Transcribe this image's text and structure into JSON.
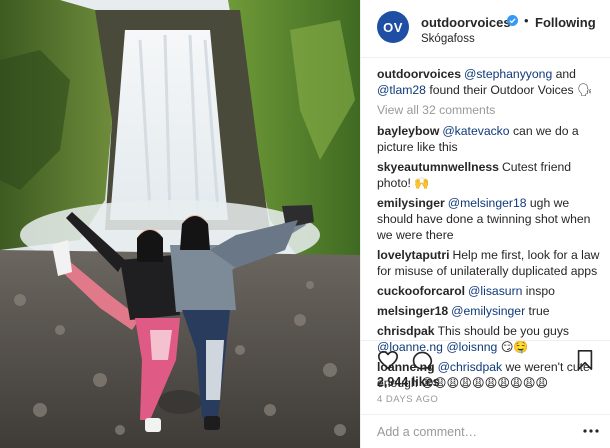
{
  "post": {
    "image": {
      "alt": "Two women posing with legs kicked up in front of Skógafoss waterfall"
    }
  },
  "header": {
    "avatar_text": "OV",
    "username": "outdoorvoices",
    "separator": "•",
    "follow_label": "Following",
    "location": "Skógafoss"
  },
  "caption": {
    "username": "outdoorvoices",
    "mention1": "@stephanyyong",
    "text1": " and ",
    "mention2": "@tlam28",
    "text2": " found their Outdoor Voices 🗣"
  },
  "view_all_label": "View all 32 comments",
  "comments": [
    {
      "user": "bayleybow",
      "mention": "@katevacko",
      "text": " can we do a picture like this"
    },
    {
      "user": "skyeautumnwellness",
      "mention": "",
      "text": "Cutest friend photo! 🙌"
    },
    {
      "user": "emilysinger",
      "mention": "@melsinger18",
      "text": " ugh we should have done a twinning shot when we were there"
    },
    {
      "user": "lovelytaputri",
      "mention": "",
      "text": "Help me first, look for a law for misuse of unilaterally duplicated apps"
    },
    {
      "user": "cuckooforcarol",
      "mention": "@lisasurn",
      "text": " inspo"
    },
    {
      "user": "melsinger18",
      "mention": "@emilysinger",
      "text": " true"
    },
    {
      "user": "chrisdpak",
      "mention": "",
      "text": "This should be you guys ",
      "mention_after": "@loanne.ng",
      "text_after": " ",
      "mention_after2": "@loisnng",
      "text_after2": " 😏🤤"
    },
    {
      "user": "loanne.ng",
      "mention": "@chrisdpak",
      "text": " we weren't cute enough 😩😩😩😩😩😩😩😩😩😩"
    }
  ],
  "actions": {
    "like_icon": "heart-icon",
    "comment_icon": "comment-icon",
    "save_icon": "bookmark-icon"
  },
  "likes_text": "2,944 likes",
  "date_text": "4 DAYS AGO",
  "add_comment": {
    "placeholder": "Add a comment…"
  },
  "colors": {
    "mention": "#0f3a7a",
    "avatar": "#1f4fa5",
    "verified": "#3897f0",
    "muted": "#999999"
  }
}
